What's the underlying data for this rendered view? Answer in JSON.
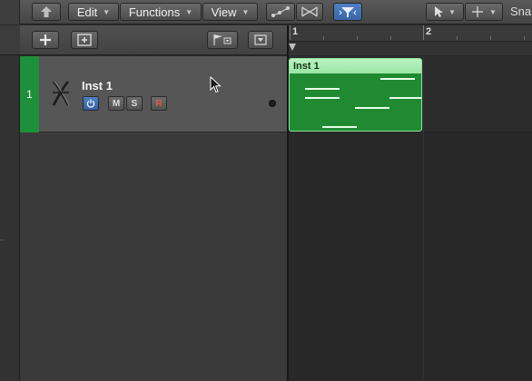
{
  "toolbar": {
    "edit_label": "Edit",
    "functions_label": "Functions",
    "view_label": "View",
    "snap_label": "Sna"
  },
  "ruler": {
    "bar_1": "1",
    "bar_2": "2"
  },
  "tracks": [
    {
      "number": "1",
      "name": "Inst 1",
      "mute_label": "M",
      "solo_label": "S",
      "record_label": "R",
      "color": "#1e8f3a"
    }
  ],
  "regions": [
    {
      "name": "Inst 1",
      "color": "#1f8a32"
    }
  ],
  "colors": {
    "accent_blue": "#3a66a8",
    "region_green": "#1f8a32",
    "track_green": "#1e8f3a"
  }
}
